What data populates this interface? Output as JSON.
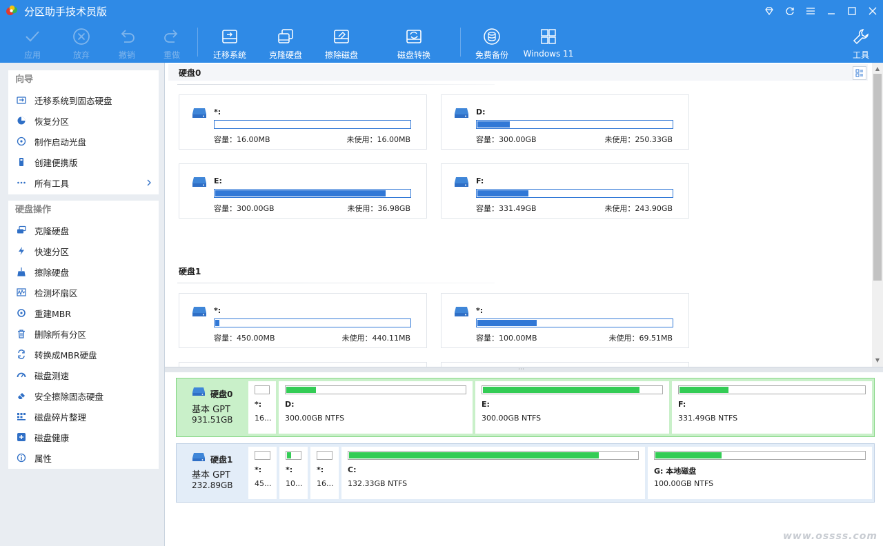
{
  "app": {
    "title": "分区助手技术员版"
  },
  "toolbar": {
    "apply": "应用",
    "discard": "放弃",
    "undo": "撤销",
    "redo": "重做",
    "migrate_os": "迁移系统",
    "clone_disk": "克隆硬盘",
    "wipe_disk": "擦除磁盘",
    "convert_disk": "磁盘转换",
    "free_backup": "免费备份",
    "windows11": "Windows 11",
    "tools": "工具"
  },
  "sidebar": {
    "wizard_title": "向导",
    "wizard_items": [
      {
        "label": "迁移系统到固态硬盘",
        "icon": "migrate-icon"
      },
      {
        "label": "恢复分区",
        "icon": "recover-icon"
      },
      {
        "label": "制作启动光盘",
        "icon": "boot-disc-icon"
      },
      {
        "label": "创建便携版",
        "icon": "usb-icon"
      },
      {
        "label": "所有工具",
        "icon": "more-icon"
      }
    ],
    "disk_ops_title": "硬盘操作",
    "disk_ops_items": [
      {
        "label": "克隆硬盘",
        "icon": "clone-icon"
      },
      {
        "label": "快速分区",
        "icon": "lightning-icon"
      },
      {
        "label": "擦除硬盘",
        "icon": "broom-icon"
      },
      {
        "label": "检测坏扇区",
        "icon": "scan-icon"
      },
      {
        "label": "重建MBR",
        "icon": "rebuild-icon"
      },
      {
        "label": "删除所有分区",
        "icon": "trash-icon"
      },
      {
        "label": "转换成MBR硬盘",
        "icon": "convert-icon"
      },
      {
        "label": "磁盘测速",
        "icon": "speed-icon"
      },
      {
        "label": "安全擦除固态硬盘",
        "icon": "eraser-icon"
      },
      {
        "label": "磁盘碎片整理",
        "icon": "defrag-icon"
      },
      {
        "label": "磁盘健康",
        "icon": "health-icon"
      },
      {
        "label": "属性",
        "icon": "info-icon"
      }
    ]
  },
  "cards_view": {
    "disk0_title": "硬盘0",
    "disk1_title": "硬盘1",
    "cap_label": "容量：",
    "free_label": "未使用：",
    "disk0": [
      {
        "name": "*:",
        "capacity": "16.00MB",
        "free": "16.00MB",
        "used_fraction": 0.0
      },
      {
        "name": "D:",
        "capacity": "300.00GB",
        "free": "250.33GB",
        "used_fraction": 0.166
      },
      {
        "name": "E:",
        "capacity": "300.00GB",
        "free": "36.98GB",
        "used_fraction": 0.877
      },
      {
        "name": "F:",
        "capacity": "331.49GB",
        "free": "243.90GB",
        "used_fraction": 0.264
      }
    ],
    "disk1": [
      {
        "name": "*:",
        "capacity": "450.00MB",
        "free": "440.11MB",
        "used_fraction": 0.022
      },
      {
        "name": "*:",
        "capacity": "100.00MB",
        "free": "69.51MB",
        "used_fraction": 0.305
      }
    ]
  },
  "disk_map": {
    "disk0": {
      "name": "硬盘0",
      "type": "基本 GPT",
      "size": "931.51GB",
      "partitions": [
        {
          "name": "*:",
          "info": "16...",
          "used_fraction": 0.0
        },
        {
          "name": "D:",
          "info": "300.00GB NTFS",
          "used_fraction": 0.166
        },
        {
          "name": "E:",
          "info": "300.00GB NTFS",
          "used_fraction": 0.877
        },
        {
          "name": "F:",
          "info": "331.49GB NTFS",
          "used_fraction": 0.264
        }
      ]
    },
    "disk1": {
      "name": "硬盘1",
      "type": "基本 GPT",
      "size": "232.89GB",
      "partitions": [
        {
          "name": "*:",
          "info": "45...",
          "used_fraction": 0.0
        },
        {
          "name": "*:",
          "info": "10...",
          "used_fraction": 0.305
        },
        {
          "name": "*:",
          "info": "16...",
          "used_fraction": 0.0
        },
        {
          "name": "C:",
          "info": "132.33GB NTFS",
          "used_fraction": 0.867
        },
        {
          "name": "G: 本地磁盘",
          "info": "100.00GB NTFS",
          "used_fraction": 0.318
        }
      ]
    }
  },
  "watermark": "www.ossss.com",
  "colors": {
    "accent": "#2f8ae6",
    "used_bar_card": "#3178d6",
    "used_bar_map": "#33cc55",
    "selected_row": "#c9f0c9"
  }
}
